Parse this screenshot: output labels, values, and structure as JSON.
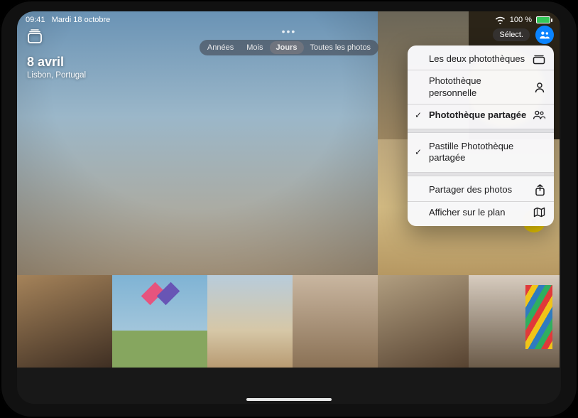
{
  "status": {
    "time": "09:41",
    "date": "Mardi 18 octobre",
    "battery_pct": "100 %"
  },
  "header": {
    "date_title": "8 avril",
    "location": "Lisbon, Portugal"
  },
  "segmented": {
    "items": [
      "Années",
      "Mois",
      "Jours",
      "Toutes les photos"
    ],
    "active_index": 2
  },
  "topright": {
    "select_label": "Sélect."
  },
  "menu": {
    "library_group": [
      {
        "label": "Les deux photothèques",
        "checked": false,
        "icon": "stack"
      },
      {
        "label": "Photothèque personnelle",
        "checked": false,
        "icon": "person"
      },
      {
        "label": "Photothèque partagée",
        "checked": true,
        "icon": "people",
        "bold": true
      }
    ],
    "badge_group": [
      {
        "label": "Pastille Photothèque partagée",
        "checked": true
      }
    ],
    "actions_group": [
      {
        "label": "Partager des photos",
        "icon": "share"
      },
      {
        "label": "Afficher sur le plan",
        "icon": "map"
      }
    ]
  }
}
